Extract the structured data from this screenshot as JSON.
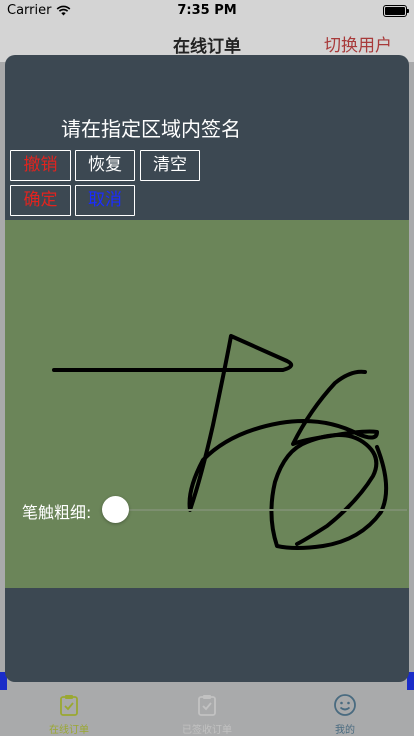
{
  "status": {
    "carrier": "Carrier",
    "time": "7:35 PM",
    "battery_percent": 100
  },
  "nav": {
    "title": "在线订单",
    "right_label": "切换用户"
  },
  "signature_panel": {
    "prompt": "请在指定区域内签名",
    "buttons": {
      "undo": {
        "label": "撤销",
        "color": "#e0241f"
      },
      "redo": {
        "label": "恢复",
        "color": "#ffffff"
      },
      "clear": {
        "label": "清空",
        "color": "#ffffff"
      },
      "confirm": {
        "label": "确定",
        "color": "#e0241f"
      },
      "cancel": {
        "label": "取消",
        "color": "#1a2cff"
      }
    },
    "canvas_color": "#6b8559",
    "brush": {
      "label": "笔触粗细:",
      "value_fraction": 0.0
    }
  },
  "tabs": [
    {
      "label": "在线订单",
      "icon": "clipboard-check-icon",
      "active": true
    },
    {
      "label": "已签收订单",
      "icon": "clipboard-check-icon",
      "active": false
    },
    {
      "label": "我的",
      "icon": "smiley-icon",
      "active": false
    }
  ],
  "colors": {
    "accent": "#9aa832",
    "inactive": "#c2c2c2",
    "my_tab": "#4a6b80"
  }
}
